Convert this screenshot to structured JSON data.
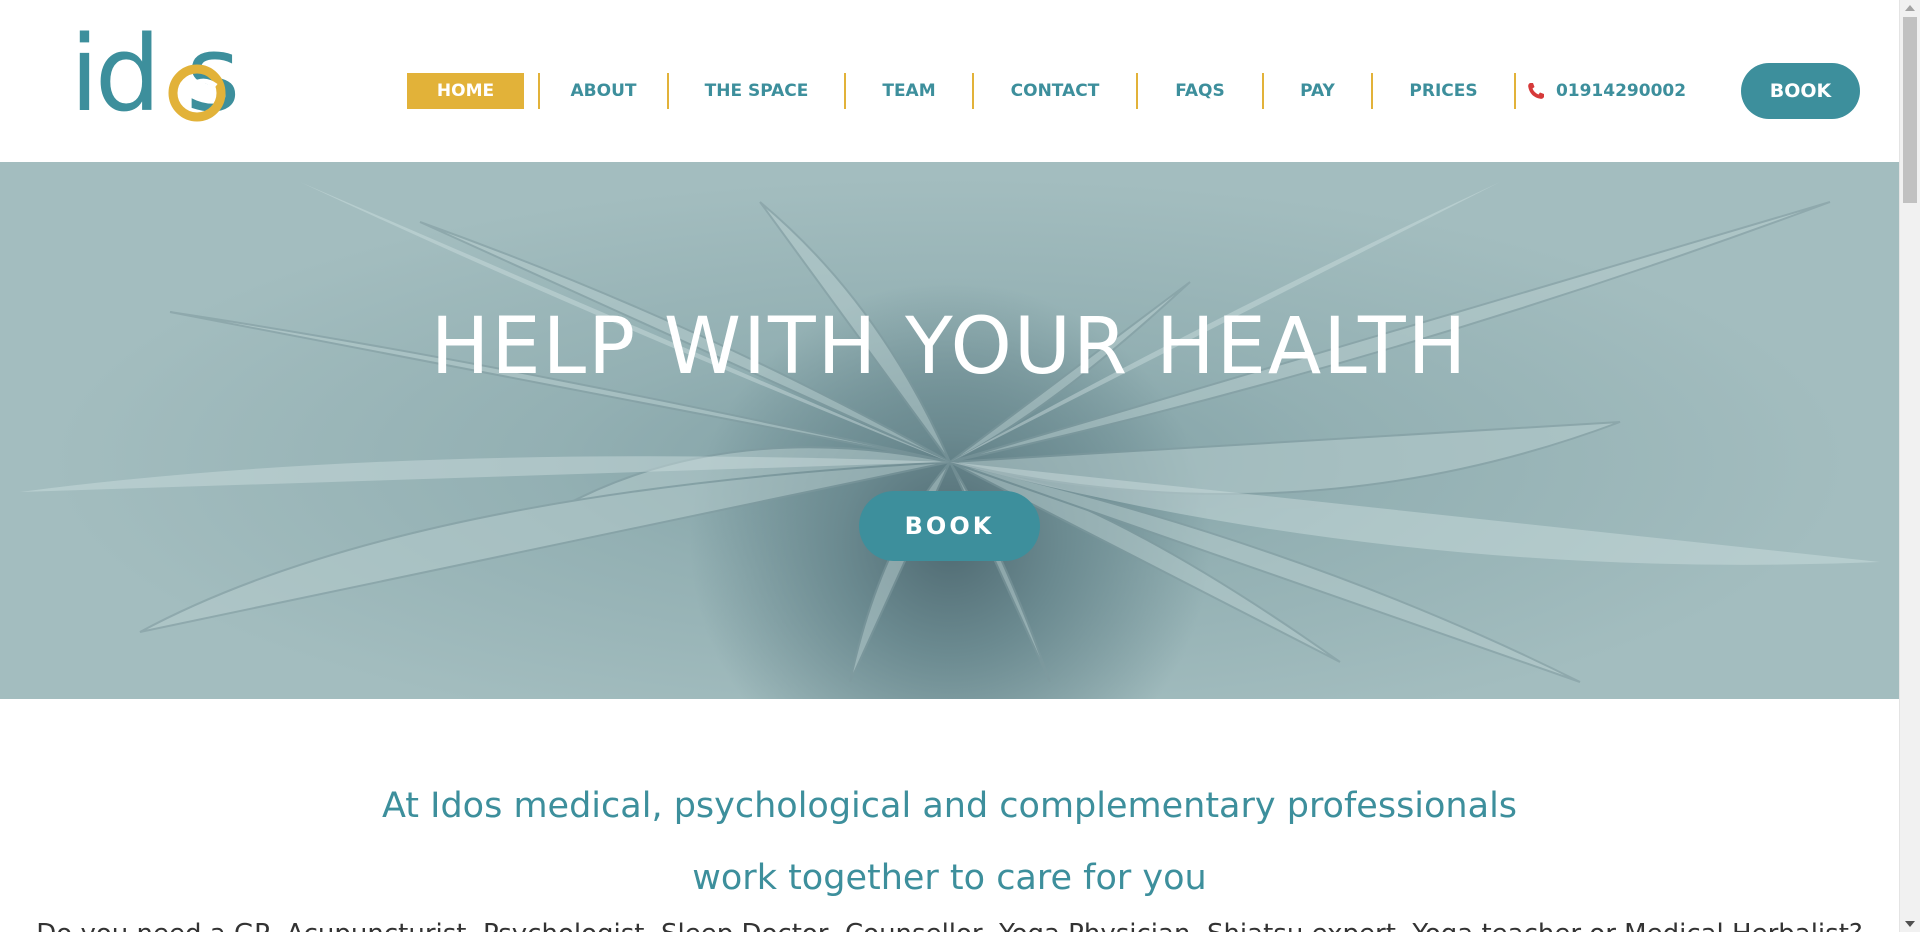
{
  "brand": {
    "logo_text": "id s",
    "colors": {
      "teal": "#3d8f9c",
      "gold": "#e2b239",
      "text_dark": "#333333",
      "phone_red": "#d63a3a"
    }
  },
  "nav": {
    "items": [
      {
        "label": "HOME"
      },
      {
        "label": "ABOUT"
      },
      {
        "label": "THE SPACE"
      },
      {
        "label": "TEAM"
      },
      {
        "label": "CONTACT"
      },
      {
        "label": "FAQS"
      },
      {
        "label": "PAY"
      },
      {
        "label": "PRICES"
      }
    ],
    "active": "HOME",
    "phone": "01914290002",
    "phone_icon": "phone-icon",
    "book_label": "BOOK"
  },
  "hero": {
    "title": "HELP WITH YOUR HEALTH",
    "book_label": "BOOK",
    "background": "succulent-plant-photo"
  },
  "intro": {
    "line1": "At Idos medical, psychological and complementary professionals",
    "line2": "work together to care for you",
    "subtext": "Do you need a GP, Acupuncturist, Psychologist, Sleep Doctor, Counsellor, Yoga Physician, Shiatsu expert, Yoga teacher or Medical Herbalist?"
  }
}
